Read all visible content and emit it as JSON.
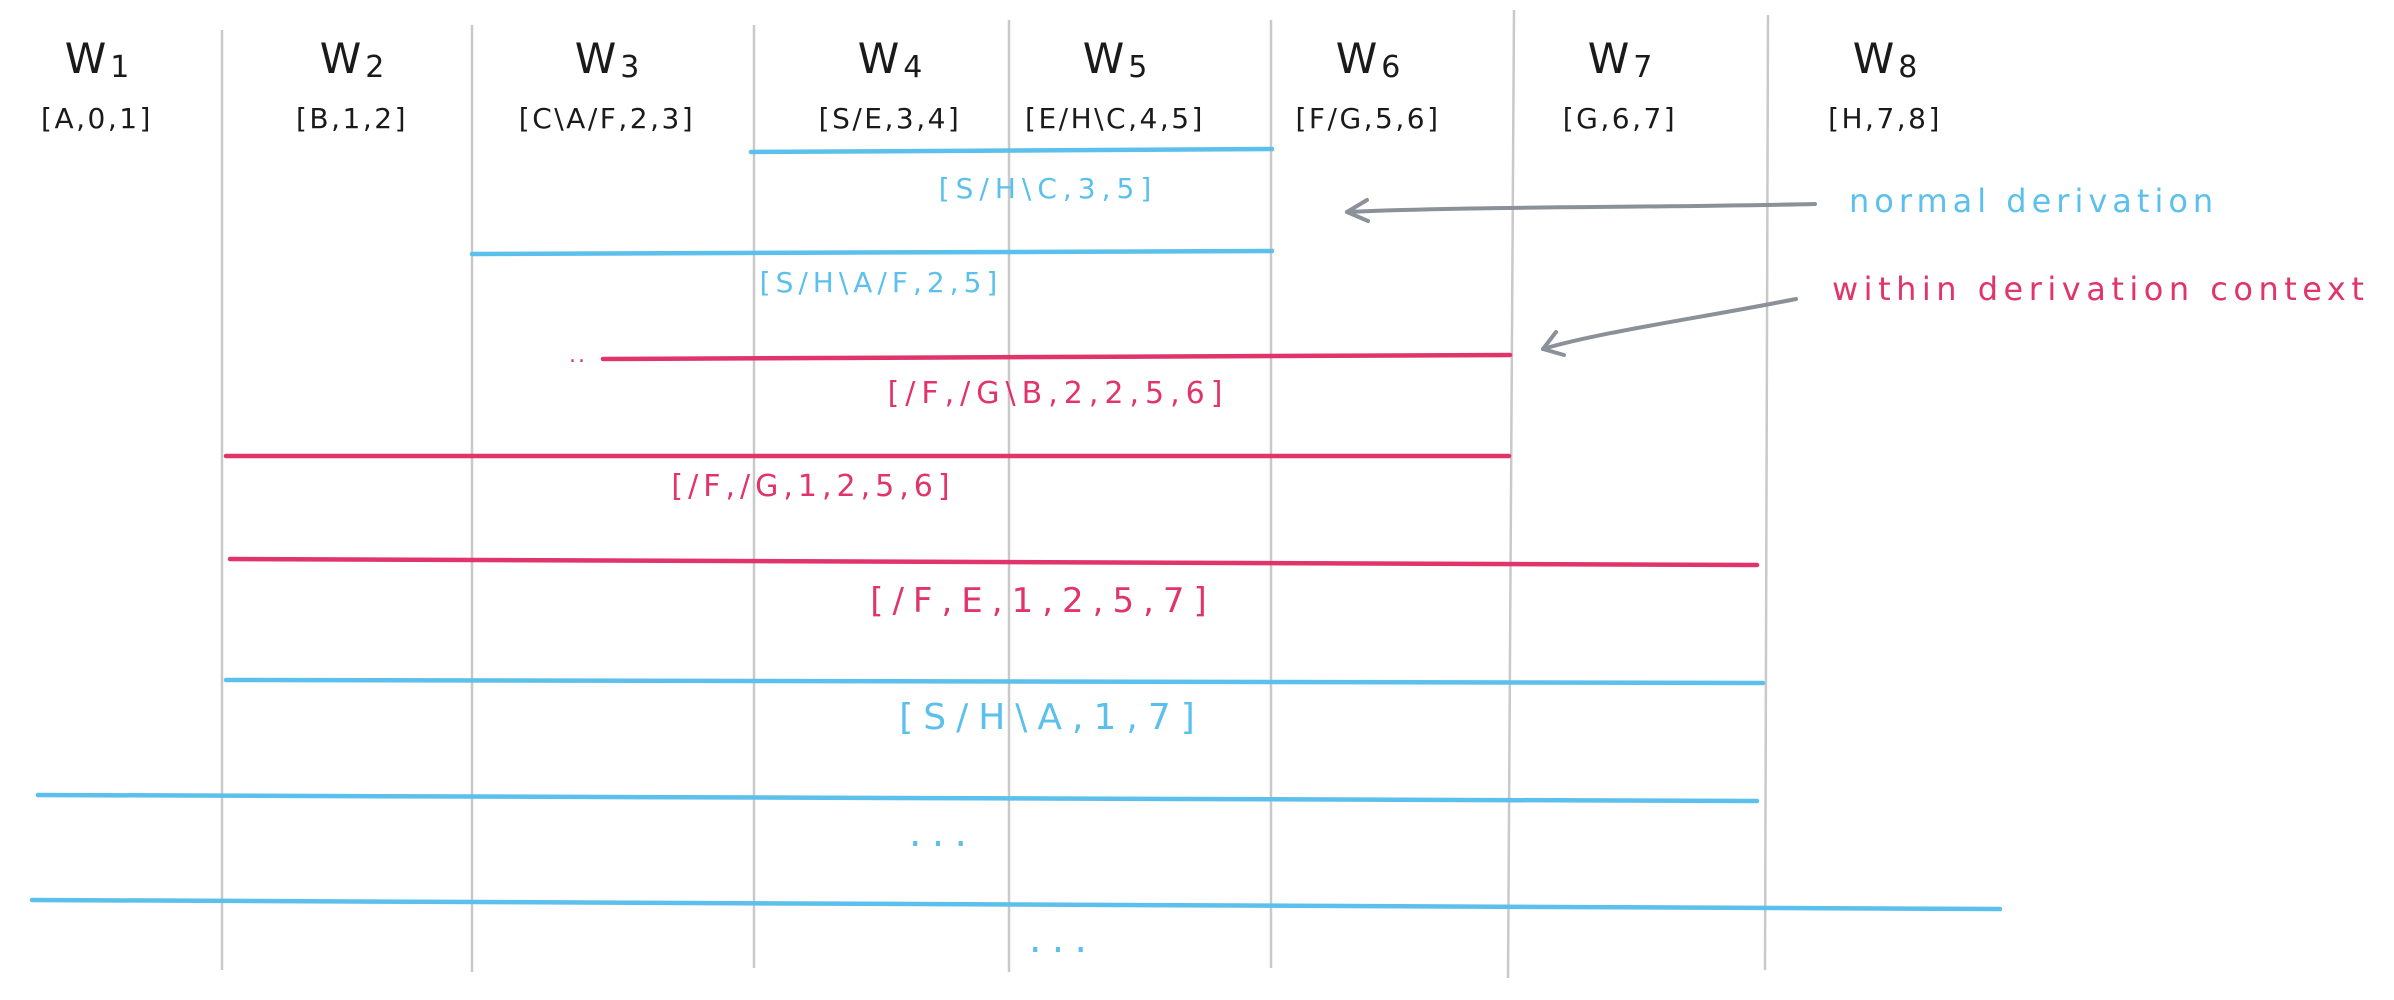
{
  "colors": {
    "normal": "#5bc0eb",
    "context": "#e0346a",
    "ink": "#1a1a1a",
    "grid": "#c9c9c9",
    "arrow": "#8a9199"
  },
  "columns": [
    {
      "word": "W1",
      "item": "[A,0,1]"
    },
    {
      "word": "W2",
      "item": "[B,1,2]"
    },
    {
      "word": "W3",
      "item": "[C\\A/F,2,3]"
    },
    {
      "word": "W4",
      "item": "[S/E,3,4]"
    },
    {
      "word": "W5",
      "item": "[E/H\\C,4,5]"
    },
    {
      "word": "W6",
      "item": "[F/G,5,6]"
    },
    {
      "word": "W7",
      "item": "[G,6,7]"
    },
    {
      "word": "W8",
      "item": "[H,7,8]"
    }
  ],
  "derivations": [
    {
      "kind": "normal",
      "label": "[S/H\\C,3,5]"
    },
    {
      "kind": "normal",
      "label": "[S/H\\A/F,2,5]"
    },
    {
      "kind": "context",
      "label": "[/F,/G\\B,2,2,5,6]",
      "prefix": ".."
    },
    {
      "kind": "context",
      "label": "[/F,/G,1,2,5,6]"
    },
    {
      "kind": "context",
      "label": "[/F,E,1,2,5,7]"
    },
    {
      "kind": "normal",
      "label": "[S/H\\A,1,7]"
    },
    {
      "kind": "normal",
      "label": "..."
    },
    {
      "kind": "normal",
      "label": "..."
    }
  ],
  "legend": {
    "normal": "normal derivation",
    "context": "within derivation context"
  }
}
